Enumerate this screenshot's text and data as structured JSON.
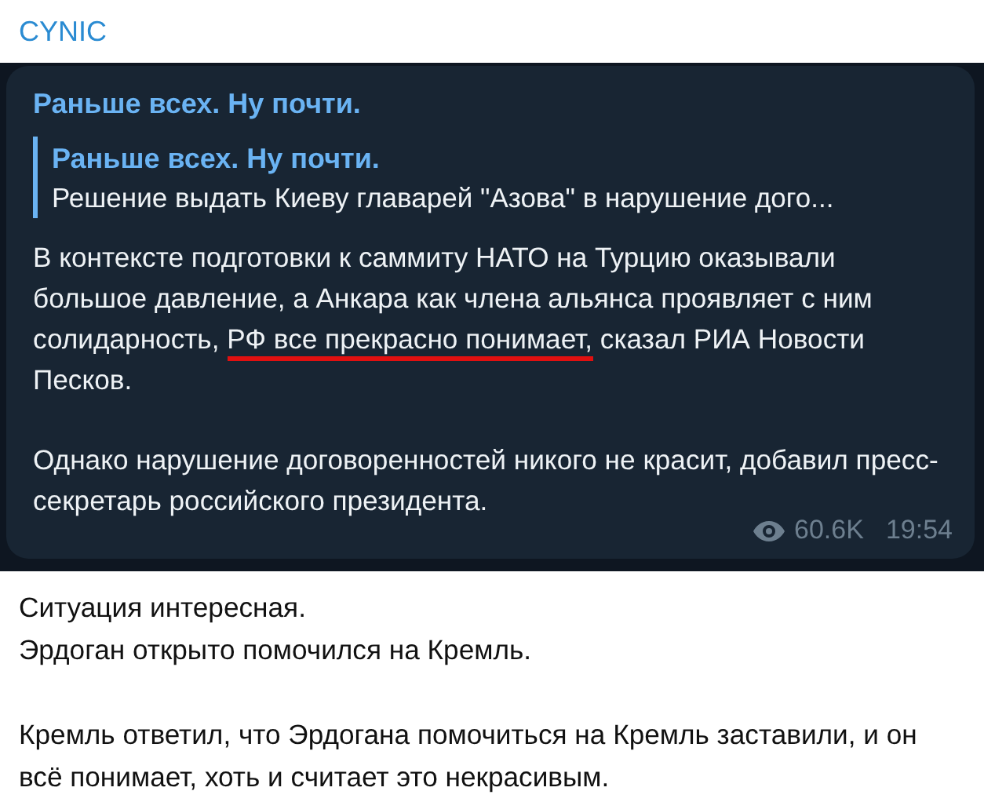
{
  "channel": {
    "name": "CYNIC"
  },
  "post": {
    "author": "Раньше всех. Ну почти.",
    "reply": {
      "author": "Раньше всех. Ну почти.",
      "text": "Решение выдать Киеву главарей \"Азова\" в нарушение дого..."
    },
    "paragraphs": [
      {
        "before": "В контексте подготовки к саммиту НАТО на Турцию оказывали большое давление, а Анкара как члена альянса проявляет с ним солидарность, ",
        "underlined": "РФ все прекрасно понимает,",
        "after": " сказал РИА Новости Песков."
      },
      {
        "before": "Однако нарушение договоренностей никого не красит, добавил пресс-секретарь российского президента."
      }
    ],
    "views": "60.6K",
    "time": "19:54"
  },
  "comment": [
    [
      "Ситуация интересная.",
      "Эрдоган открыто помочился на Кремль."
    ],
    [
      "Кремль ответил, что Эрдогана помочиться на Кремль заставили, и он всё понимает, хоть и считает это некрасивым."
    ]
  ]
}
